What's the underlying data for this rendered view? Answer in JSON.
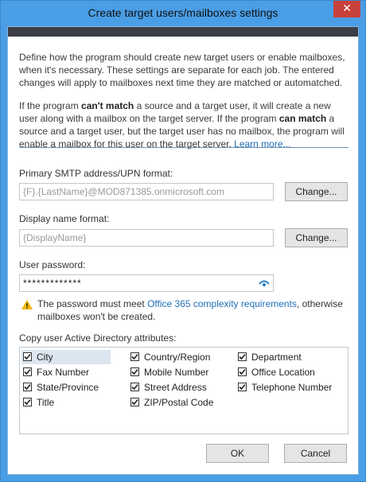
{
  "dialog": {
    "title": "Create target users/mailboxes settings",
    "close_glyph": "✕"
  },
  "description": {
    "para1": "Define how the program should create new target users or enable mailboxes, when it's necessary. These settings are separate for each job. The entered changes will apply to mailboxes next time they are matched or automatched.",
    "para2_a": "If the program ",
    "para2_b": "can't match",
    "para2_c": " a source and a target user, it will create a new user along with a mailbox on the target server. If the program ",
    "para2_d": "can match",
    "para2_e": " a source and a target user, but the target user has no mailbox, the program will enable a mailbox for this user on the target server. ",
    "learn_more": "Learn more..."
  },
  "smtp": {
    "label": "Primary SMTP address/UPN format:",
    "value": "{F}.{LastName}@MOD871385.onmicrosoft.com",
    "change": "Change..."
  },
  "display": {
    "label": "Display name format:",
    "value": "{DisplayName}",
    "change": "Change..."
  },
  "password": {
    "label": "User password:",
    "value": "*************"
  },
  "warning": {
    "text_a": "The password must meet ",
    "link": "Office 365 complexity requirements",
    "text_b": ", otherwise mailboxes won't be created."
  },
  "attributes": {
    "label": "Copy user Active Directory attributes:",
    "col1": [
      {
        "label": "City",
        "checked": true,
        "selected": true
      },
      {
        "label": "Fax Number",
        "checked": true
      },
      {
        "label": "State/Province",
        "checked": true
      },
      {
        "label": "Title",
        "checked": true
      }
    ],
    "col2": [
      {
        "label": "Country/Region",
        "checked": true
      },
      {
        "label": "Mobile Number",
        "checked": true
      },
      {
        "label": "Street Address",
        "checked": true
      },
      {
        "label": "ZIP/Postal Code",
        "checked": true
      }
    ],
    "col3": [
      {
        "label": "Department",
        "checked": true
      },
      {
        "label": "Office Location",
        "checked": true
      },
      {
        "label": "Telephone Number",
        "checked": true
      }
    ]
  },
  "footer": {
    "ok": "OK",
    "cancel": "Cancel"
  },
  "colors": {
    "accent": "#4a9ee6",
    "link": "#1f6fb5",
    "close": "#c7413a",
    "warning": "#f2b600"
  }
}
